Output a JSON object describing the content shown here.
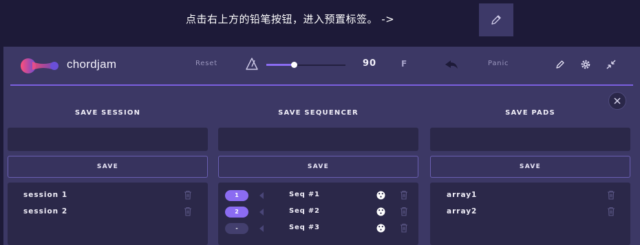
{
  "banner": {
    "instruction": "点击右上方的铅笔按钮，进入预置标签。 ->",
    "pencil_icon": "pencil-icon"
  },
  "topbar": {
    "brand": "chordjam",
    "reset_label": "Reset",
    "tempo_slider": {
      "value": 0.35
    },
    "bpm": "90",
    "key": "F",
    "panic_label": "Panic",
    "icons": [
      "metronome-icon",
      "undo-icon",
      "pencil-icon",
      "gear-icon",
      "collapse-icon",
      "close-icon"
    ]
  },
  "colors": {
    "accent": "#8b6cf2",
    "logo_pink": "#ff4f7a",
    "logo_purple": "#7b5fe0",
    "panel_bg": "#3c3865",
    "field_bg": "#2b2849"
  },
  "columns": {
    "session": {
      "title": "SAVE SESSION",
      "input_value": "",
      "save_label": "SAVE",
      "items": [
        "session 1",
        "session 2"
      ]
    },
    "sequencer": {
      "title": "SAVE SEQUENCER",
      "input_value": "",
      "save_label": "SAVE",
      "items": [
        {
          "slot": "1",
          "name": "Seq #1",
          "assigned": true
        },
        {
          "slot": "2",
          "name": "Seq #2",
          "assigned": true
        },
        {
          "slot": "-",
          "name": "Seq #3",
          "assigned": false
        }
      ]
    },
    "pads": {
      "title": "SAVE PADS",
      "input_value": "",
      "save_label": "SAVE",
      "items": [
        "array1",
        "array2"
      ]
    }
  }
}
